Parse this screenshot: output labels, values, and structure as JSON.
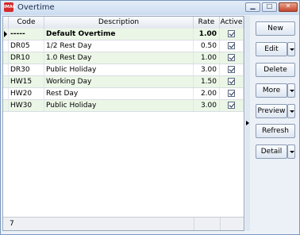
{
  "window": {
    "title": "Overtime",
    "icon": "app-logo-icon",
    "icon_text": "IMAG"
  },
  "grid": {
    "columns": {
      "code": "Code",
      "description": "Description",
      "rate": "Rate",
      "active": "Active"
    },
    "rows": [
      {
        "code": "-----",
        "description": "Default Overtime",
        "rate": "1.00",
        "active": true
      },
      {
        "code": "DR05",
        "description": "1/2 Rest Day",
        "rate": "0.50",
        "active": true
      },
      {
        "code": "DR10",
        "description": "1.0 Rest Day",
        "rate": "1.00",
        "active": true
      },
      {
        "code": "DR30",
        "description": "Public Holiday",
        "rate": "3.00",
        "active": true
      },
      {
        "code": "HW15",
        "description": "Working Day",
        "rate": "1.50",
        "active": true
      },
      {
        "code": "HW20",
        "description": "Rest Day",
        "rate": "2.00",
        "active": true
      },
      {
        "code": "HW30",
        "description": "Public Holiday",
        "rate": "3.00",
        "active": true
      }
    ],
    "record_count": "7"
  },
  "buttons": {
    "new": "New",
    "edit": "Edit",
    "delete": "Delete",
    "more": "More",
    "preview": "Preview",
    "refresh": "Refresh",
    "detail": "Detail"
  },
  "colors": {
    "row_alt": "#ebf6e6",
    "close": "#c2462b"
  }
}
